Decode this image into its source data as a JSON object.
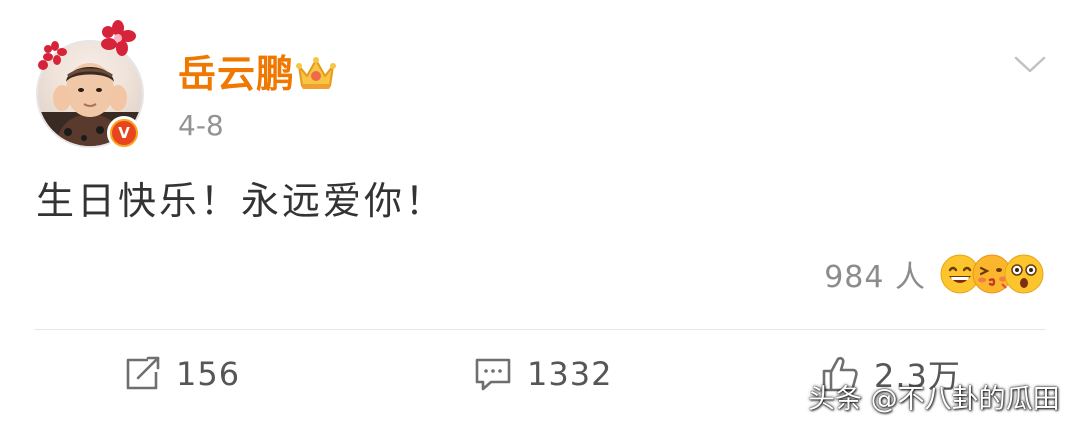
{
  "post": {
    "author": {
      "name": "岳云鹏",
      "avatar_icon": "avatar-photo",
      "verified_badge_text": "V",
      "crown_icon": "crown-icon"
    },
    "date": "4-8",
    "text": "生日快乐！永远爱你！",
    "reactions": {
      "count_label": "984 人",
      "emojis": [
        "grinning-face-icon",
        "kissing-face-icon",
        "shocked-face-icon"
      ]
    },
    "actions": {
      "repost_count": "156",
      "comment_count": "1332",
      "like_count": "2.3万"
    }
  },
  "watermark": "头条 @不八卦的瓜田",
  "colors": {
    "username": "#f07800",
    "text": "#333333",
    "muted": "#939393"
  }
}
